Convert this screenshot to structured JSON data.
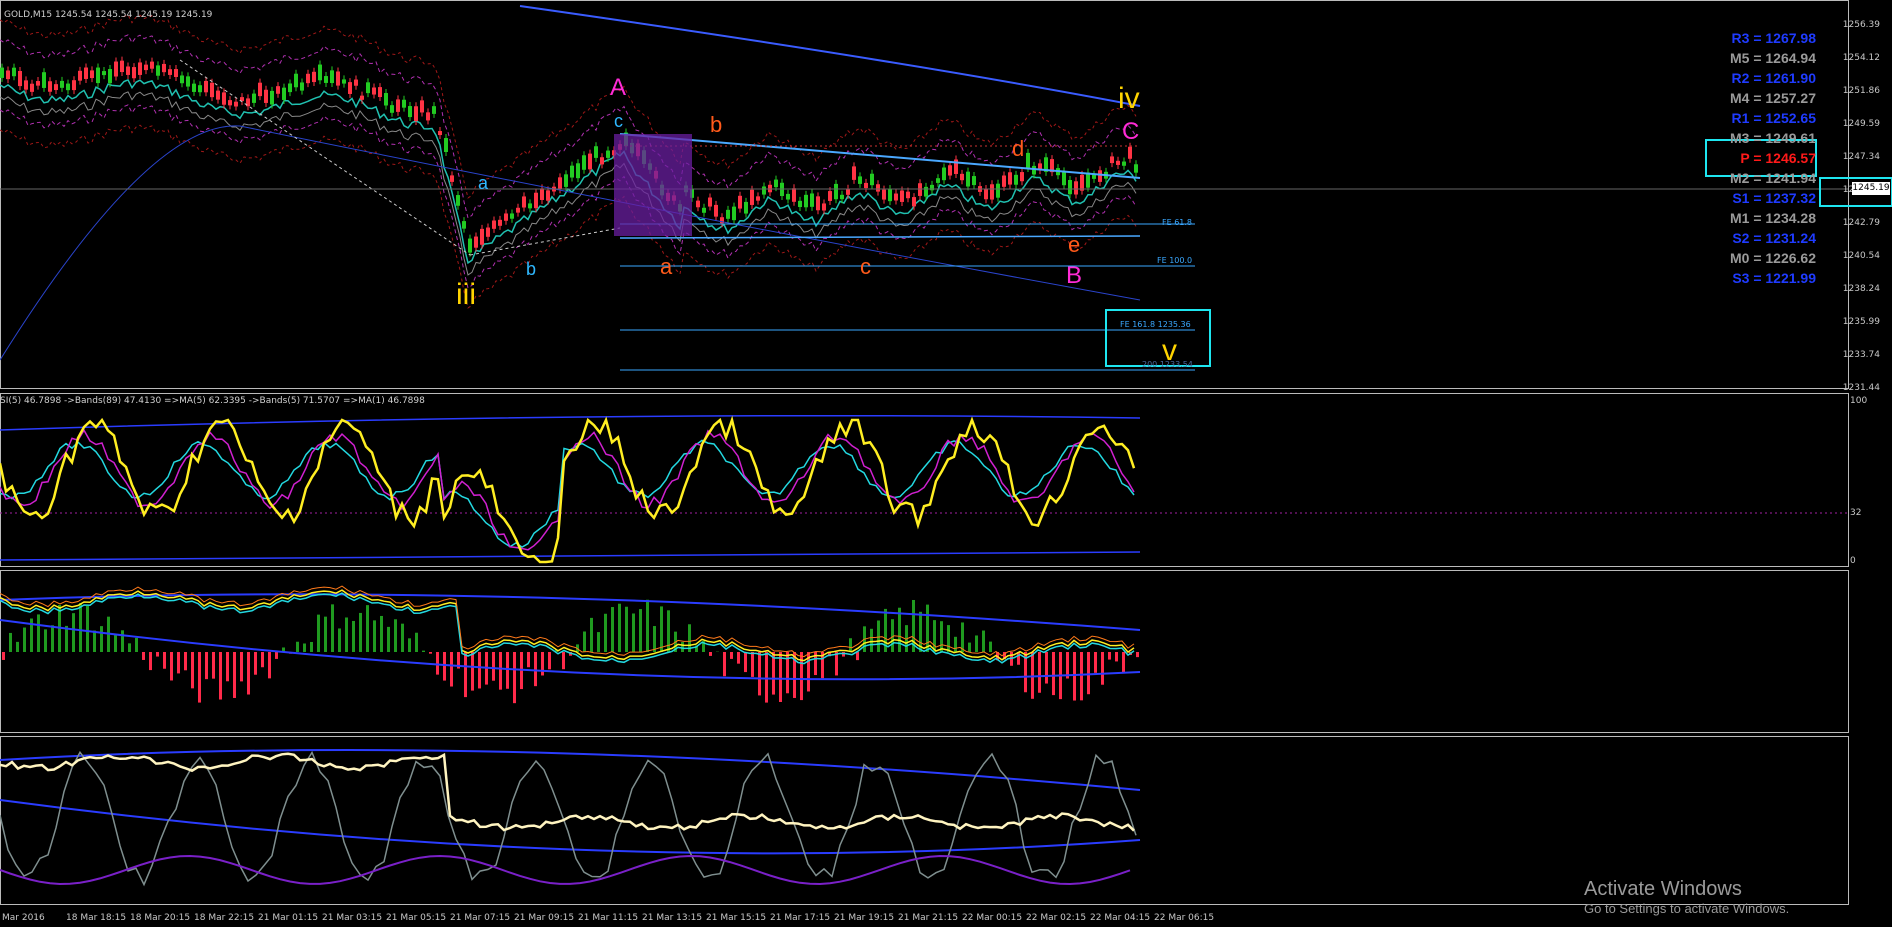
{
  "chart": {
    "symbol_header": "GOLD,M15  1245.54 1245.54 1245.19 1245.19",
    "current_price": "1245.19",
    "price_scale": [
      "1256.39",
      "1254.12",
      "1251.86",
      "1249.59",
      "1247.34",
      "1245.07",
      "1242.79",
      "1240.54",
      "1238.24",
      "1235.99",
      "1233.74",
      "1231.44"
    ],
    "oscillator_header": "SI(5) 46.7898  ->Bands(89) 47.4130  =>MA(5) 62.3395  ->Bands(5) 71.5707  =>MA(1) 46.7898",
    "oscillator_scale": [
      "100",
      "32",
      "0"
    ],
    "time_axis": [
      "Mar 2016",
      "18 Mar 18:15",
      "18 Mar 20:15",
      "18 Mar 22:15",
      "21 Mar 01:15",
      "21 Mar 03:15",
      "21 Mar 05:15",
      "21 Mar 07:15",
      "21 Mar 09:15",
      "21 Mar 11:15",
      "21 Mar 13:15",
      "21 Mar 15:15",
      "21 Mar 17:15",
      "21 Mar 19:15",
      "21 Mar 21:15",
      "22 Mar 00:15",
      "22 Mar 02:15",
      "22 Mar 04:15",
      "22 Mar 06:15"
    ]
  },
  "pivots": [
    {
      "text": "R3 = 1267.98",
      "color": "#1f3bff"
    },
    {
      "text": "M5 = 1264.94",
      "color": "#9a9a9a"
    },
    {
      "text": "R2 = 1261.90",
      "color": "#1f3bff"
    },
    {
      "text": "M4 = 1257.27",
      "color": "#9a9a9a"
    },
    {
      "text": "R1 = 1252.65",
      "color": "#1f3bff"
    },
    {
      "text": "M3 = 1249.61",
      "color": "#9a9a9a"
    },
    {
      "text": "P  = 1246.57",
      "color": "#ff1a1a"
    },
    {
      "text": "M2 = 1241.94",
      "color": "#9a9a9a"
    },
    {
      "text": "S1 = 1237.32",
      "color": "#1f3bff"
    },
    {
      "text": "M1 = 1234.28",
      "color": "#9a9a9a"
    },
    {
      "text": "S2 = 1231.24",
      "color": "#1f3bff"
    },
    {
      "text": "M0 = 1226.62",
      "color": "#9a9a9a"
    },
    {
      "text": "S3 = 1221.99",
      "color": "#1f3bff"
    }
  ],
  "fibonacci": {
    "fe61": "FE 61.8",
    "fe100": "FE 100.0",
    "fe161": "FE 161.8 1235.36",
    "fe200": "200 1233.54"
  },
  "waves": {
    "iii": {
      "text": "iii",
      "color": "#ffd400"
    },
    "iv": {
      "text": "iv",
      "color": "#ffd400"
    },
    "v": {
      "text": "v",
      "color": "#ffd400"
    },
    "A": {
      "text": "A",
      "color": "#ff2bd6"
    },
    "B": {
      "text": "B",
      "color": "#ff2bd6"
    },
    "C": {
      "text": "C",
      "color": "#ff2bd6"
    },
    "a1": {
      "text": "a",
      "color": "#2fb8ff"
    },
    "b1": {
      "text": "b",
      "color": "#2fb8ff"
    },
    "c1": {
      "text": "c",
      "color": "#2fb8ff"
    },
    "a2": {
      "text": "a",
      "color": "#ff5a1a"
    },
    "b2": {
      "text": "b",
      "color": "#ff5a1a"
    },
    "c2": {
      "text": "c",
      "color": "#ff5a1a"
    },
    "d2": {
      "text": "d",
      "color": "#ff5a1a"
    },
    "e2": {
      "text": "e",
      "color": "#ff5a1a"
    }
  },
  "watermark": {
    "title": "Activate Windows",
    "subtitle": "Go to Settings to activate Windows."
  }
}
